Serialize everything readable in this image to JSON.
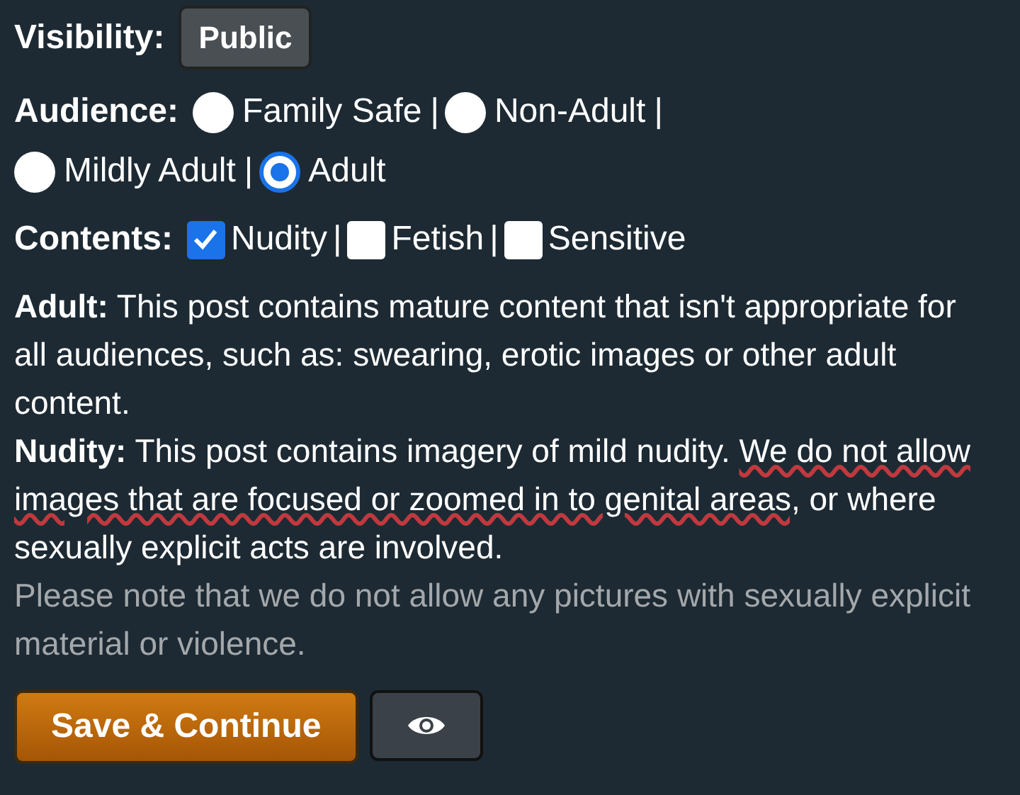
{
  "visibility": {
    "label": "Visibility:",
    "button": "Public"
  },
  "audience": {
    "label": "Audience:",
    "options": [
      {
        "label": "Family Safe",
        "selected": false,
        "separator": "|"
      },
      {
        "label": "Non-Adult",
        "selected": false,
        "separator": "|"
      },
      {
        "label": "Mildly Adult",
        "selected": false,
        "separator": "|"
      },
      {
        "label": "Adult",
        "selected": true
      }
    ]
  },
  "contents": {
    "label": "Contents:",
    "options": [
      {
        "label": "Nudity",
        "checked": true,
        "separator": "|"
      },
      {
        "label": "Fetish",
        "checked": false,
        "separator": "|"
      },
      {
        "label": "Sensitive",
        "checked": false
      }
    ]
  },
  "notes": [
    {
      "label": "Adult:",
      "text": "This post contains mature content that isn't appropriate for all audiences, such as: swearing, erotic images or other adult content."
    },
    {
      "label": "Nudity:",
      "text": "This post contains imagery of mild nudity.",
      "marked_text": "We do not allow images that are focused or zoomed in to genital areas,",
      "after_text": "or where sexually explicit acts are involved."
    }
  ],
  "disclaimer": "Please note that we do not allow any pictures with sexually explicit material or violence.",
  "buttons": [
    {
      "kind": "primary",
      "label": "Save & Continue"
    },
    {
      "kind": "preview"
    }
  ]
}
